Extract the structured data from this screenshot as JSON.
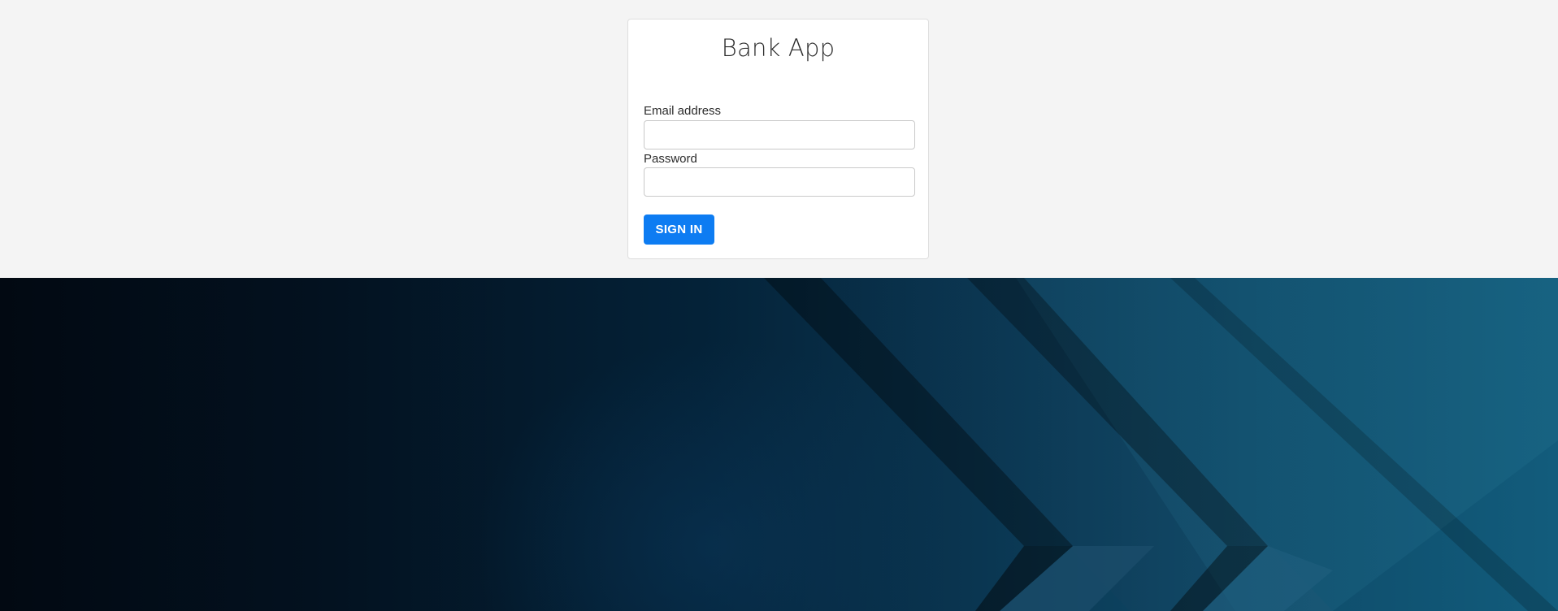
{
  "app": {
    "title": "Bank App"
  },
  "form": {
    "email_label": "Email address",
    "email_value": "",
    "password_label": "Password",
    "password_value": "",
    "submit_label": "SIGN IN"
  },
  "colors": {
    "page_background": "#f4f4f4",
    "card_background": "#ffffff",
    "primary_button": "#0d7cf2",
    "hero_dark": "#020912",
    "hero_light": "#125c7c"
  },
  "icons": {
    "hero_decoration": "diagonal-stripes-background"
  }
}
